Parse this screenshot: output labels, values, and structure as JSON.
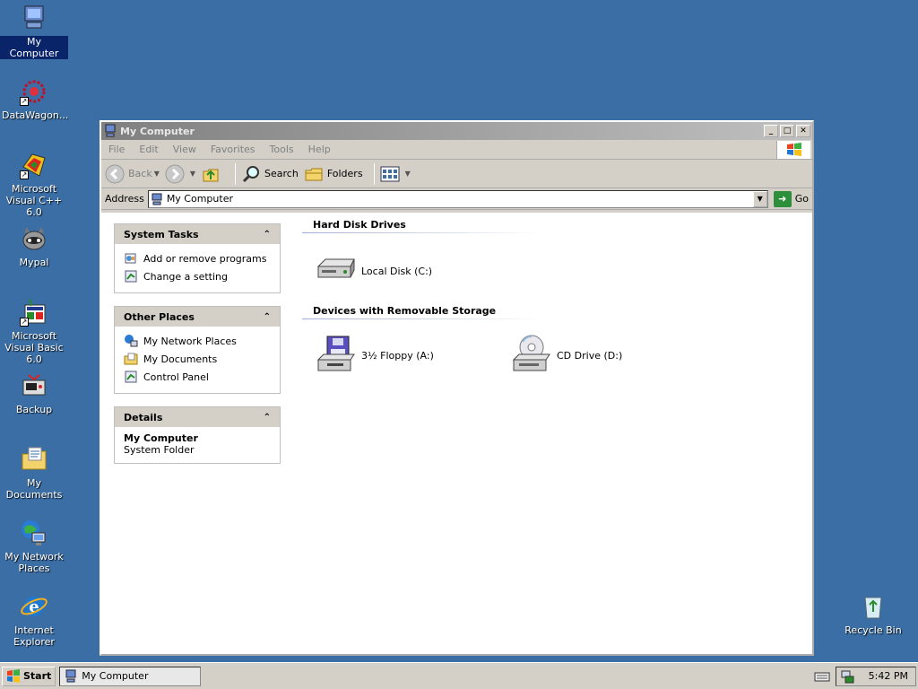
{
  "desktop": {
    "icons": [
      {
        "label": "My Computer"
      },
      {
        "label": "DataWagon..."
      },
      {
        "label": "Microsoft Visual C++ 6.0"
      },
      {
        "label": "Mypal"
      },
      {
        "label": "Microsoft Visual Basic 6.0"
      },
      {
        "label": "Backup"
      },
      {
        "label": "My Documents"
      },
      {
        "label": "My Network Places"
      },
      {
        "label": "Internet Explorer"
      },
      {
        "label": "Recycle Bin"
      }
    ]
  },
  "window": {
    "title": "My Computer",
    "menu": [
      "File",
      "Edit",
      "View",
      "Favorites",
      "Tools",
      "Help"
    ],
    "toolbar": {
      "back": "Back",
      "search": "Search",
      "folders": "Folders"
    },
    "address": {
      "label": "Address",
      "value": "My Computer",
      "go": "Go"
    },
    "panels": {
      "system_tasks": {
        "title": "System Tasks",
        "items": [
          "Add or remove programs",
          "Change a setting"
        ]
      },
      "other_places": {
        "title": "Other Places",
        "items": [
          "My Network Places",
          "My Documents",
          "Control Panel"
        ]
      },
      "details": {
        "title": "Details",
        "name": "My Computer",
        "type": "System Folder"
      }
    },
    "groups": {
      "hdd": {
        "title": "Hard Disk Drives",
        "items": [
          "Local Disk (C:)"
        ]
      },
      "removable": {
        "title": "Devices with Removable Storage",
        "items": [
          "3½ Floppy (A:)",
          "CD Drive (D:)"
        ]
      }
    }
  },
  "taskbar": {
    "start": "Start",
    "task": "My Computer",
    "clock": "5:42 PM"
  }
}
